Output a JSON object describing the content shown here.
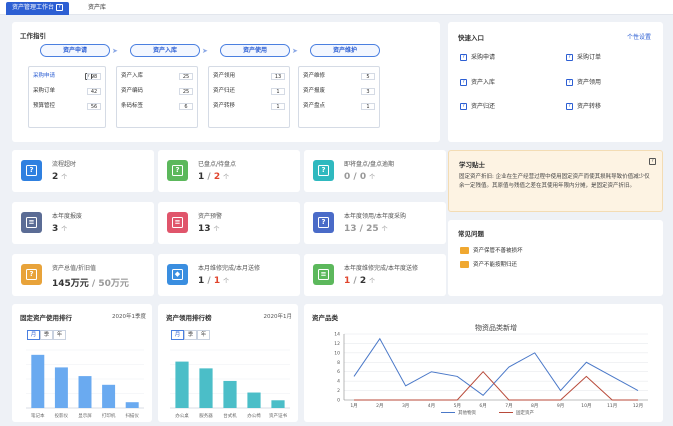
{
  "tabs": [
    {
      "label": "资产管理工作台",
      "active": true
    },
    {
      "label": "资产库",
      "active": false
    }
  ],
  "workflow": {
    "title": "工作指引",
    "stages": [
      {
        "label": "资产申请",
        "rows": [
          {
            "label": "采购申请",
            "value": "98",
            "highlight": true,
            "help": true
          },
          {
            "label": "采购订单",
            "value": "42"
          },
          {
            "label": "预算管控",
            "value": "56"
          }
        ]
      },
      {
        "label": "资产入库",
        "rows": [
          {
            "label": "资产入库",
            "value": "25"
          },
          {
            "label": "资产编码",
            "value": "25"
          },
          {
            "label": "条码标签",
            "value": "6"
          }
        ]
      },
      {
        "label": "资产使用",
        "rows": [
          {
            "label": "资产领用",
            "value": "13"
          },
          {
            "label": "资产归还",
            "value": "1"
          },
          {
            "label": "资产转移",
            "value": "1"
          }
        ]
      },
      {
        "label": "资产维护",
        "rows": [
          {
            "label": "资产维修",
            "value": "5"
          },
          {
            "label": "资产报废",
            "value": "3"
          },
          {
            "label": "资产盘点",
            "value": "1"
          }
        ]
      }
    ]
  },
  "quick": {
    "title": "快速入口",
    "settings_link": "个性设置",
    "items": [
      "采购申请",
      "采购订单",
      "资产入库",
      "资产领用",
      "资产归还",
      "资产转移"
    ]
  },
  "stats": [
    {
      "label": "流程超时",
      "value": "2",
      "unit": "个",
      "color": "#2f80e0",
      "glyph": "?"
    },
    {
      "label": "已盘点/待盘点",
      "value_parts": [
        {
          "t": "1",
          "c": "normal"
        },
        {
          "t": " / ",
          "c": "gray"
        },
        {
          "t": "2",
          "c": "red"
        }
      ],
      "unit": "个",
      "color": "#5cb85c",
      "glyph": "?"
    },
    {
      "label": "即将盘点/盘点逾期",
      "value_parts": [
        {
          "t": "0",
          "c": "gray"
        },
        {
          "t": " / ",
          "c": "gray"
        },
        {
          "t": "0",
          "c": "gray"
        }
      ],
      "unit": "个",
      "color": "#2fb9bf",
      "glyph": "?"
    },
    {
      "label": "本年度报废",
      "value": "3",
      "unit": "个",
      "color": "#5b6c95",
      "glyph": "≡"
    },
    {
      "label": "资产预警",
      "value": "13",
      "unit": "个",
      "color": "#e0556b",
      "glyph": "≡"
    },
    {
      "label": "本年度领用/本年度采购",
      "value_parts": [
        {
          "t": "13",
          "c": "gray"
        },
        {
          "t": " / ",
          "c": "gray"
        },
        {
          "t": "25",
          "c": "gray"
        }
      ],
      "unit": "个",
      "color": "#4a6bc8",
      "glyph": "?"
    },
    {
      "label": "资产总值/折旧值",
      "value_parts": [
        {
          "t": "145万元",
          "c": "normal"
        },
        {
          "t": " / ",
          "c": "gray"
        },
        {
          "t": "50万元",
          "c": "gray"
        }
      ],
      "unit": "",
      "color": "#e8a33a",
      "glyph": "?"
    },
    {
      "label": "本月维修完成/本月送修",
      "value_parts": [
        {
          "t": "1",
          "c": "normal"
        },
        {
          "t": " / ",
          "c": "gray"
        },
        {
          "t": "1",
          "c": "red"
        }
      ],
      "unit": "个",
      "color": "#3a8ee0",
      "glyph": "◆"
    },
    {
      "label": "本年度维修完成/本年度送修",
      "value_parts": [
        {
          "t": "1",
          "c": "red"
        },
        {
          "t": " / ",
          "c": "gray"
        },
        {
          "t": "2",
          "c": "normal"
        }
      ],
      "unit": "个",
      "color": "#5cb85c",
      "glyph": "≡"
    }
  ],
  "tip": {
    "title": "学习贴士",
    "text": "固定资产折旧: 企业在生产经营过程中使用固定资产而使其损耗导致价值减少仅余一定残值。其原值与残值之差在其使用年限内分摊，是固定资产折旧。"
  },
  "faq": {
    "title": "常见问题",
    "items": [
      "资产保管不善被损坏",
      "资产不能按期归还"
    ]
  },
  "rank1": {
    "title": "固定资产使用排行",
    "period": "2020年1季度",
    "segments": [
      "月",
      "季",
      "年"
    ],
    "active": 0
  },
  "rank2": {
    "title": "资产领用排行榜",
    "period": "2020年1月",
    "segments": [
      "月",
      "季",
      "年"
    ],
    "active": 0
  },
  "category_title": "资产品类",
  "chart_data": [
    {
      "type": "bar",
      "categories": [
        "笔记本",
        "投影仪",
        "显示屏",
        "打印机",
        "扫描仪"
      ],
      "values": [
        55,
        42,
        33,
        24,
        6
      ],
      "color": "#6aaaf0",
      "ylim": [
        0,
        60
      ]
    },
    {
      "type": "bar",
      "categories": [
        "办公桌",
        "服务器",
        "台式机",
        "办公椅",
        "资产证书"
      ],
      "values": [
        48,
        41,
        28,
        16,
        8
      ],
      "color": "#4bbec8",
      "ylim": [
        0,
        60
      ]
    },
    {
      "type": "line",
      "title": "物资品类新增",
      "categories": [
        "1月",
        "2月",
        "3月",
        "4月",
        "5月",
        "6月",
        "7月",
        "8月",
        "9月",
        "10月",
        "11月",
        "12月"
      ],
      "ylim": [
        0,
        14
      ],
      "yticks": [
        0,
        2,
        4,
        6,
        8,
        10,
        12,
        14
      ],
      "series": [
        {
          "name": "其他物资",
          "color": "#4a78c8",
          "values": [
            5,
            13,
            3,
            6,
            5,
            1,
            7,
            10,
            2,
            8,
            5,
            2
          ]
        },
        {
          "name": "固定资产",
          "color": "#b84a3a",
          "values": [
            0,
            0,
            0,
            0,
            0,
            6,
            0,
            0,
            0,
            5,
            0,
            0
          ]
        }
      ]
    }
  ]
}
